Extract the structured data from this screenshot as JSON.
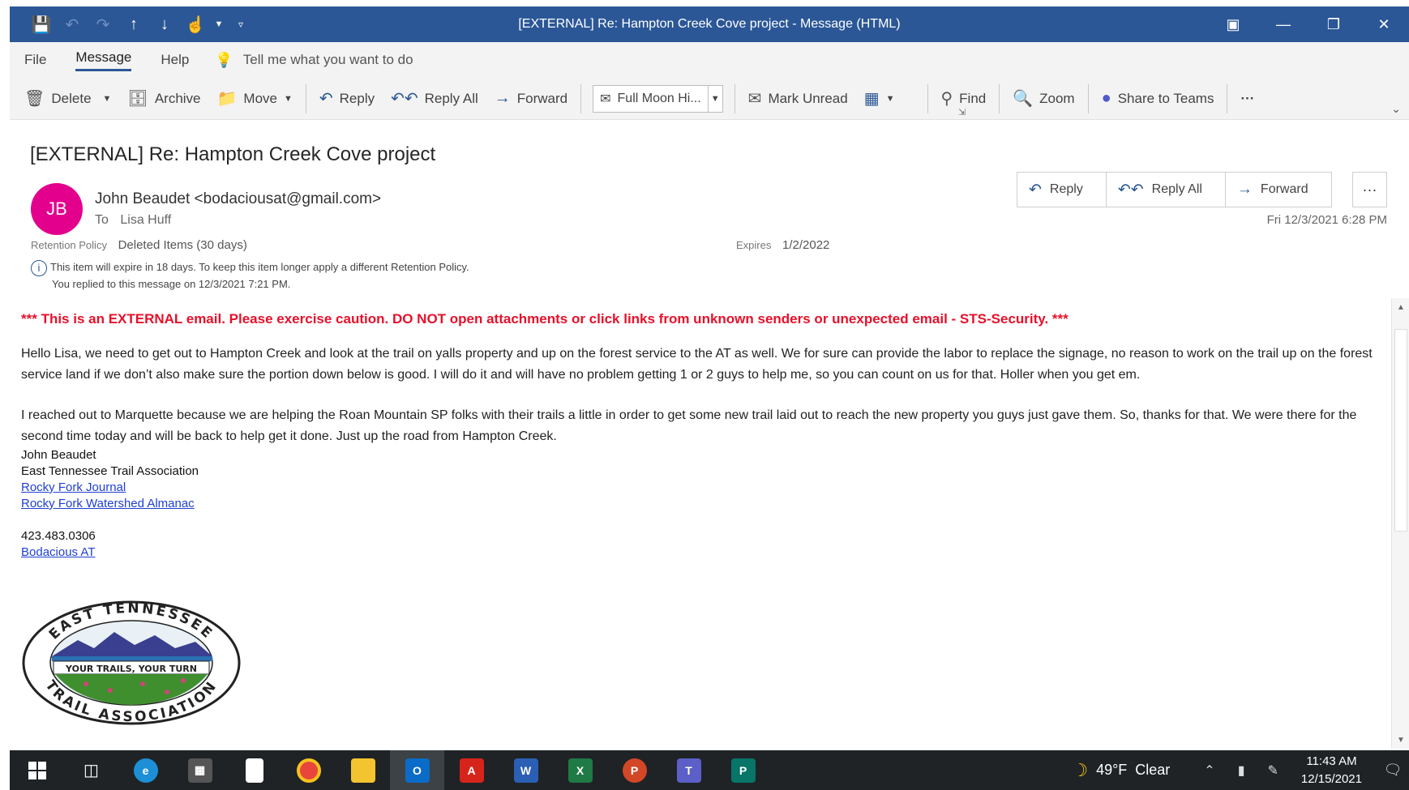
{
  "window": {
    "title": "[EXTERNAL] Re: Hampton Creek Cove project  -  Message (HTML)"
  },
  "menu": {
    "items": [
      "File",
      "Message",
      "Help"
    ],
    "active": "Message",
    "tell_me": "Tell me what you want to do"
  },
  "ribbon": {
    "delete": "Delete",
    "archive": "Archive",
    "move": "Move",
    "reply": "Reply",
    "reply_all": "Reply All",
    "forward": "Forward",
    "quick_step": "Full Moon Hi...",
    "mark_unread": "Mark Unread",
    "find": "Find",
    "zoom": "Zoom",
    "share_teams": "Share to Teams",
    "more": "···"
  },
  "message": {
    "subject": "[EXTERNAL] Re: Hampton Creek Cove project",
    "avatar_initials": "JB",
    "avatar_color": "#e3008c",
    "sender": "John Beaudet <bodaciousat@gmail.com>",
    "to_label": "To",
    "to": "Lisa Huff",
    "retention_label": "Retention Policy",
    "retention_value": "Deleted Items (30 days)",
    "expires_label": "Expires",
    "expires_value": "1/2/2022",
    "info_line1": "This item will expire in 18 days. To keep this item longer apply a different Retention Policy.",
    "info_line2": "You replied to this message on 12/3/2021 7:21 PM.",
    "date": "Fri 12/3/2021 6:28 PM",
    "actions": {
      "reply": "Reply",
      "reply_all": "Reply All",
      "forward": "Forward",
      "more": "···"
    }
  },
  "body": {
    "warning": "*** This is an EXTERNAL email. Please exercise caution. DO NOT open attachments or click links from unknown senders or unexpected email - STS-Security. ***",
    "para1": "Hello Lisa, we need to get out to Hampton Creek and look at the trail on yalls property and up on the forest service to the AT as well. We for sure can provide the labor to replace the signage, no reason to work on the trail up on the forest service land if we don’t also make sure the portion down below is good. I will do it and will have no problem getting 1 or 2 guys to help me, so you can count on us for that. Holler when you get em.",
    "para2": "I reached out to Marquette because we are helping the Roan Mountain SP folks with their trails a little in order to get some new trail laid out to reach the new property you guys just gave them. So, thanks for that. We were there for the second time today and will be back to help get it done. Just up the road from Hampton Creek.",
    "sig_name": "John Beaudet",
    "sig_org": "East Tennessee Trail Association",
    "sig_link1": "Rocky Fork Journal",
    "sig_link2": "Rocky Fork Watershed Almanac",
    "sig_phone": "423.483.0306",
    "sig_link3": "Bodacious AT"
  },
  "logo": {
    "top_text": "EAST TENNESSEE",
    "middle_text": "YOUR TRAILS, YOUR TURN",
    "bottom_text": "TRAIL ASSOCIATION"
  },
  "taskbar": {
    "weather_temp": "49°F",
    "weather_desc": "Clear",
    "time": "11:43 AM",
    "date": "12/15/2021"
  }
}
